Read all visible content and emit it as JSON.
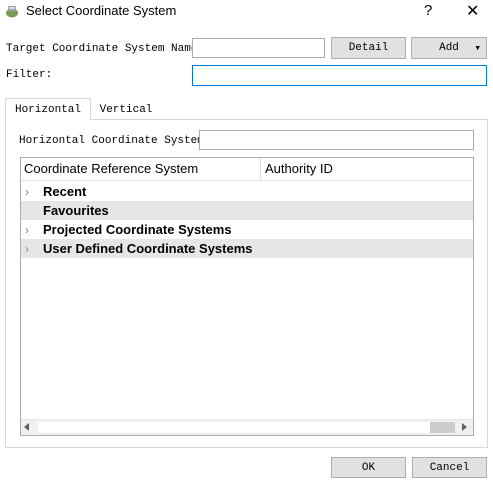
{
  "window": {
    "title": "Select Coordinate System",
    "help_glyph": "?",
    "close_glyph": "✕",
    "app_icon": "qgis-logo-icon"
  },
  "top": {
    "target_label": "Target Coordinate System Name:",
    "target_value": "",
    "detail_button": "Detail",
    "add_button": "Add",
    "add_arrow": "▾",
    "filter_label": "Filter:",
    "filter_value": ""
  },
  "tabs": [
    {
      "label": "Horizontal",
      "selected": true
    },
    {
      "label": "Vertical",
      "selected": false
    }
  ],
  "horizontal": {
    "hcs_label": "Horizontal Coordinate System:",
    "hcs_value": "",
    "columns": [
      "Coordinate Reference System",
      "Authority ID"
    ],
    "rows": [
      {
        "label": "Recent",
        "expandable": true
      },
      {
        "label": "Favourites",
        "expandable": false
      },
      {
        "label": "Projected Coordinate Systems",
        "expandable": true
      },
      {
        "label": "User Defined Coordinate Systems",
        "expandable": true
      }
    ]
  },
  "footer": {
    "ok": "OK",
    "cancel": "Cancel"
  }
}
